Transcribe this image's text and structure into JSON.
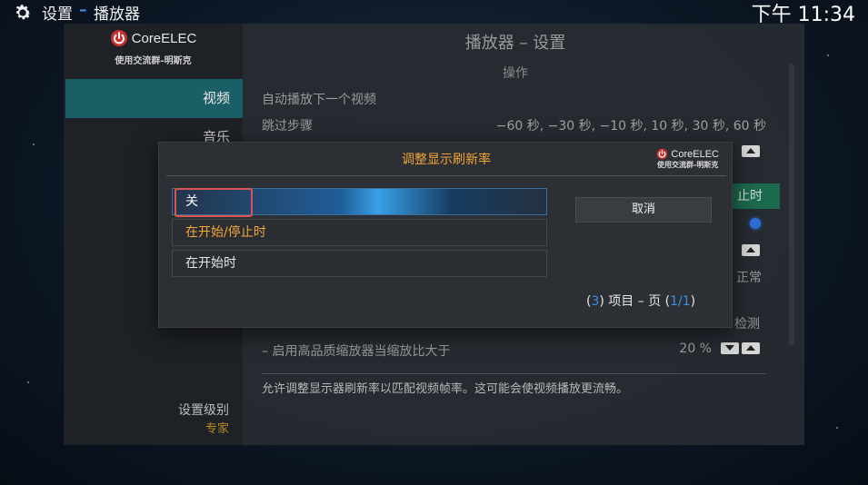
{
  "topbar": {
    "crumb_settings": "设置",
    "crumb_separator": "–",
    "crumb_player": "播放器",
    "clock": "下午 11:34"
  },
  "sidebar": {
    "logo_text": "CoreELEC",
    "logo_sub": "使用交流群-明斯克",
    "items": [
      {
        "label": "视频",
        "active": true
      },
      {
        "label": "音乐",
        "active": false
      }
    ],
    "settings_level_label": "设置级别",
    "settings_level_value": "专家"
  },
  "panel": {
    "title": "播放器 – 设置",
    "section": "操作",
    "rows": [
      {
        "label": "自动播放下一个视频",
        "value": ""
      },
      {
        "label": "跳过步骤",
        "value": "−60 秒, −30 秒, −10 秒, 10 秒, 30 秒, 60 秒"
      },
      {
        "label": "– 启用高品质缩放器当缩放比大于",
        "value": "20 %"
      }
    ],
    "peek_green": "止时",
    "peek_normal": "正常",
    "peek_detect": "检测",
    "description": "允许调整显示器刷新率以匹配视频帧率。这可能会使视频播放更流畅。"
  },
  "dialog": {
    "title": "调整显示刷新率",
    "logo_text": "CoreELEC",
    "logo_sub": "使用交流群-明斯克",
    "options": [
      {
        "label": "关",
        "state": "focused"
      },
      {
        "label": "在开始/停止时",
        "state": "selected"
      },
      {
        "label": "在开始时",
        "state": "normal"
      }
    ],
    "cancel_label": "取消",
    "pager": {
      "open_paren": "(",
      "count": "3",
      "text_mid": ") 项目 – 页 (",
      "page": "1/1",
      "close_paren": ")"
    }
  },
  "colors": {
    "accent_orange": "#f4a637",
    "accent_blue": "#3d8fe6",
    "active_teal": "#1b5f66",
    "focus_red": "#d9534f"
  },
  "icons": {
    "settings": "gear-icon",
    "power": "power-icon"
  }
}
